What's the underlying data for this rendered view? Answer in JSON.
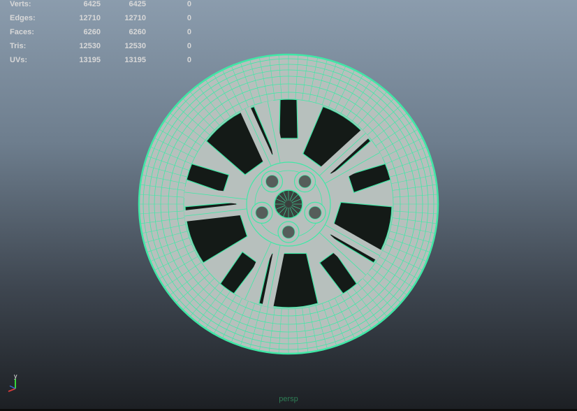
{
  "hud": {
    "rows": [
      {
        "label": "Verts:",
        "v1": "6425",
        "v2": "6425",
        "v3": "0"
      },
      {
        "label": "Edges:",
        "v1": "12710",
        "v2": "12710",
        "v3": "0"
      },
      {
        "label": "Faces:",
        "v1": "6260",
        "v2": "6260",
        "v3": "0"
      },
      {
        "label": "Tris:",
        "v1": "12530",
        "v2": "12530",
        "v3": "0"
      },
      {
        "label": "UVs:",
        "v1": "13195",
        "v2": "13195",
        "v3": "0"
      }
    ]
  },
  "camera": {
    "label": "persp"
  },
  "axis": {
    "y_label": "y"
  },
  "colors": {
    "wireframe": "#3fe8a6",
    "face_fill": "#b7c0bd",
    "hole_fill": "#141a17",
    "hud_text": "#d8d8d8",
    "camera_text": "#2e7d55",
    "axis_x": "#d63a3a",
    "axis_y": "#3ad63a",
    "axis_z": "#3a6ad6"
  }
}
